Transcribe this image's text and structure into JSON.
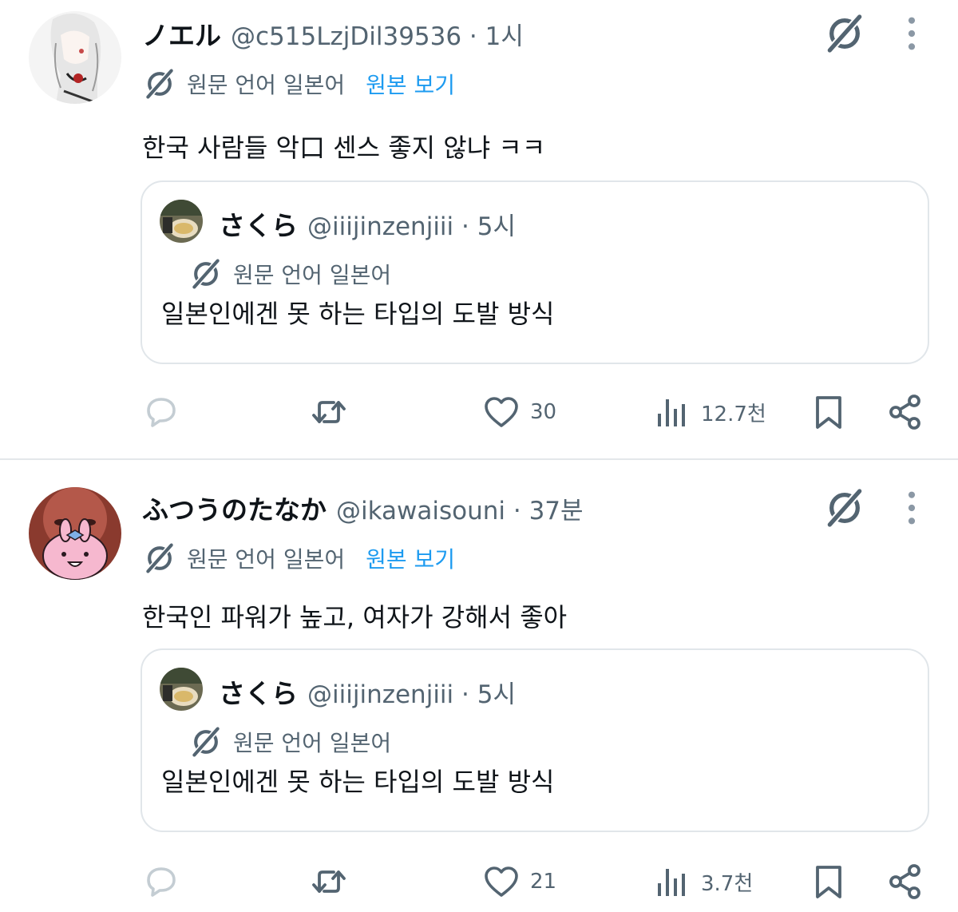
{
  "colors": {
    "accent": "#1d9bf0",
    "text_primary": "#0f1419",
    "text_secondary": "#536471",
    "border": "#e1e6ea"
  },
  "tweets": [
    {
      "display_name": "ノエル",
      "handle_time": "@c515LzjDil39536 · 1시",
      "translate_label": "원문 언어 일본어",
      "show_original": "원본 보기",
      "text": "한국 사람들 악口 센스 좋지 않냐 ㅋㅋ",
      "quote": {
        "display_name": "さくら",
        "handle_time": "@iiijinzenjiii · 5시",
        "translate_label": "원문 언어 일본어",
        "text": "일본인에겐 못 하는 타입의 도발 방식"
      },
      "actions": {
        "reply_icon": "reply-icon",
        "retweet_icon": "retweet-icon",
        "like_count": "30",
        "views_count": "12.7천"
      }
    },
    {
      "display_name": "ふつうのたなか",
      "handle_time": "@ikawaisouni · 37분",
      "translate_label": "원문 언어 일본어",
      "show_original": "원본 보기",
      "text": "한국인 파워가 높고, 여자가 강해서 좋아",
      "quote": {
        "display_name": "さくら",
        "handle_time": "@iiijinzenjiii · 5시",
        "translate_label": "원문 언어 일본어",
        "text": "일본인에겐 못 하는 타입의 도발 방식"
      },
      "actions": {
        "reply_icon": "reply-icon",
        "retweet_icon": "retweet-icon",
        "like_count": "21",
        "views_count": "3.7천"
      }
    }
  ]
}
